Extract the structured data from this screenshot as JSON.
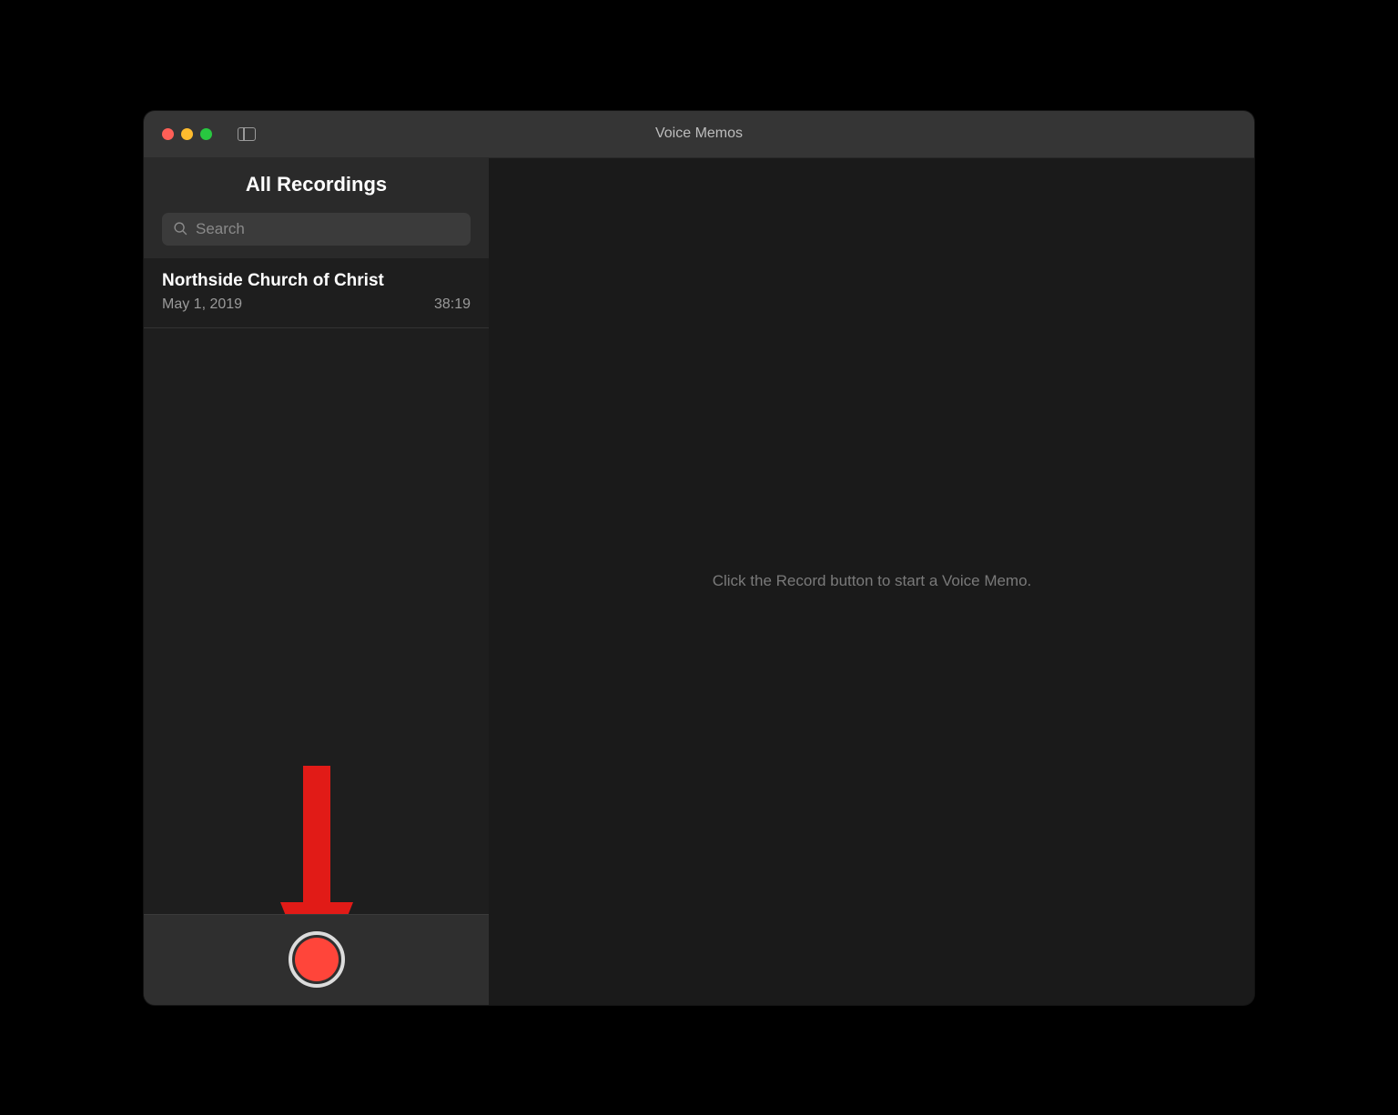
{
  "window": {
    "title": "Voice Memos"
  },
  "sidebar": {
    "title": "All Recordings",
    "search_placeholder": "Search",
    "recordings": [
      {
        "title": "Northside Church of Christ",
        "date": "May 1, 2019",
        "duration": "38:19"
      }
    ]
  },
  "main": {
    "placeholder": "Click the Record button to start a Voice Memo."
  },
  "colors": {
    "record_red": "#ff453a",
    "annotation_red": "#e11b17"
  }
}
